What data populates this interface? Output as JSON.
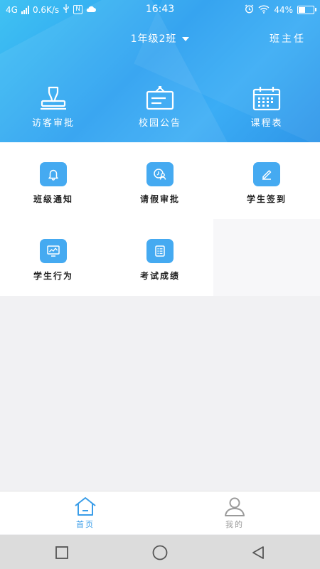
{
  "status_bar": {
    "network": "4G",
    "speed": "0.6K/s",
    "nfc": "N",
    "time": "16:43",
    "battery": "44%"
  },
  "header": {
    "class_selector": "1年级2班",
    "role": "班主任",
    "items": [
      {
        "label": "访客审批",
        "icon": "stamp-icon"
      },
      {
        "label": "校园公告",
        "icon": "notice-board-icon"
      },
      {
        "label": "课程表",
        "icon": "calendar-icon"
      }
    ]
  },
  "grid": {
    "items": [
      {
        "label": "班级通知",
        "icon": "bell-icon"
      },
      {
        "label": "请假审批",
        "icon": "clock-user-icon"
      },
      {
        "label": "学生签到",
        "icon": "pen-icon"
      },
      {
        "label": "学生行为",
        "icon": "monitor-chart-icon"
      },
      {
        "label": "考试成绩",
        "icon": "list-icon"
      }
    ]
  },
  "tabs": [
    {
      "label": "首页",
      "icon": "home-icon",
      "active": true
    },
    {
      "label": "我的",
      "icon": "user-icon",
      "active": false
    }
  ],
  "colors": {
    "header_blue": "#2a9ff0",
    "icon_tile": "#45aaf1",
    "active_tab": "#3a9de8",
    "inactive_tab": "#9a9a9a"
  }
}
